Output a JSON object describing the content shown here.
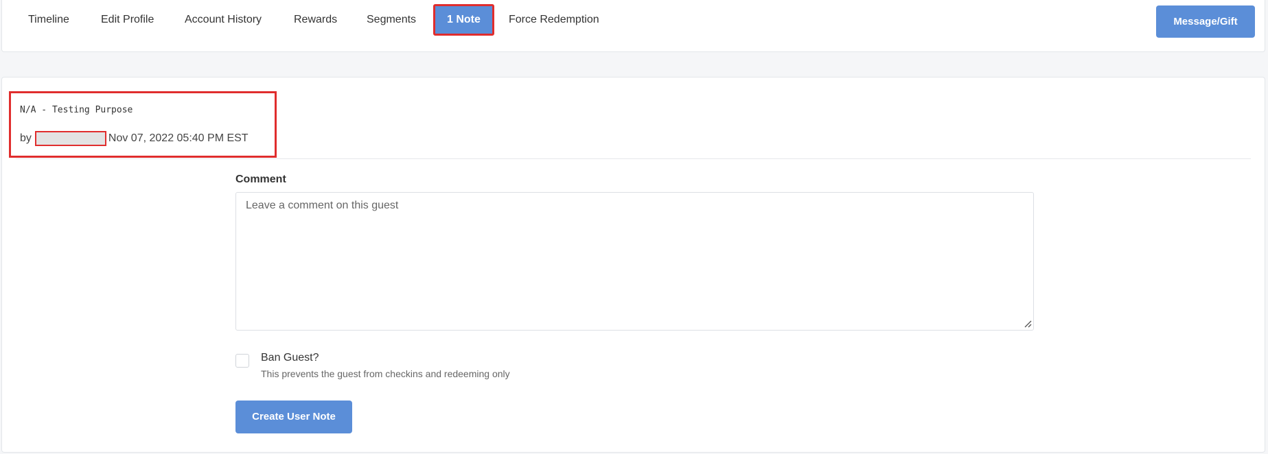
{
  "tabs": [
    {
      "label": "Timeline"
    },
    {
      "label": "Edit Profile"
    },
    {
      "label": "Account History"
    },
    {
      "label": "Rewards"
    },
    {
      "label": "Segments"
    },
    {
      "label": "1 Note"
    },
    {
      "label": "Force Redemption"
    }
  ],
  "active_tab": "1 Note",
  "header": {
    "message_button_label": "Message/Gift"
  },
  "note": {
    "text": "N/A - Testing Purpose",
    "by_label": "by",
    "timestamp": "Nov 07, 2022 05:40 PM EST"
  },
  "comment": {
    "label": "Comment",
    "placeholder": "Leave a comment on this guest",
    "value": ""
  },
  "ban": {
    "label": "Ban Guest?",
    "help": "This prevents the guest from checkins and redeeming only",
    "checked": false
  },
  "actions": {
    "create_label": "Create User Note"
  },
  "colors": {
    "primary": "#5b8ed8",
    "highlight": "#e02d2d"
  }
}
